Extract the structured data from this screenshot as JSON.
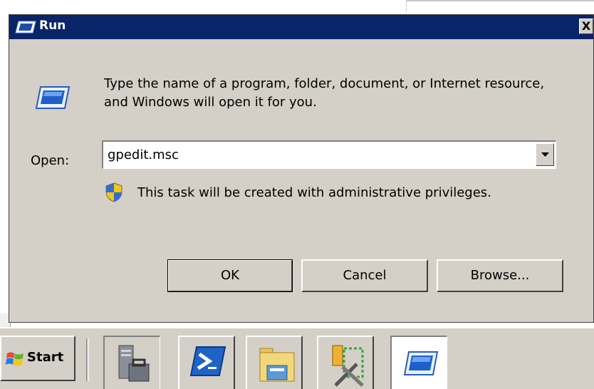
{
  "dialog": {
    "title": "Run",
    "close_label": "X",
    "description": "Type the name of a program, folder, document, or Internet resource, and Windows will open it for you.",
    "open_label": "Open:",
    "open_value": "gpedit.msc",
    "admin_note": "This task will be created with administrative privileges.",
    "ok_label": "OK",
    "cancel_label": "Cancel",
    "browse_label": "Browse..."
  },
  "taskbar": {
    "start_label": "Start",
    "quick_launch": [
      {
        "icon": "server-manager-icon"
      },
      {
        "icon": "powershell-icon"
      },
      {
        "icon": "file-explorer-icon"
      },
      {
        "icon": "admin-tools-icon"
      },
      {
        "icon": "run-icon",
        "active": true
      }
    ]
  },
  "colors": {
    "titlebar": "#0a246a",
    "face": "#d4d0c8",
    "text": "#000000"
  }
}
